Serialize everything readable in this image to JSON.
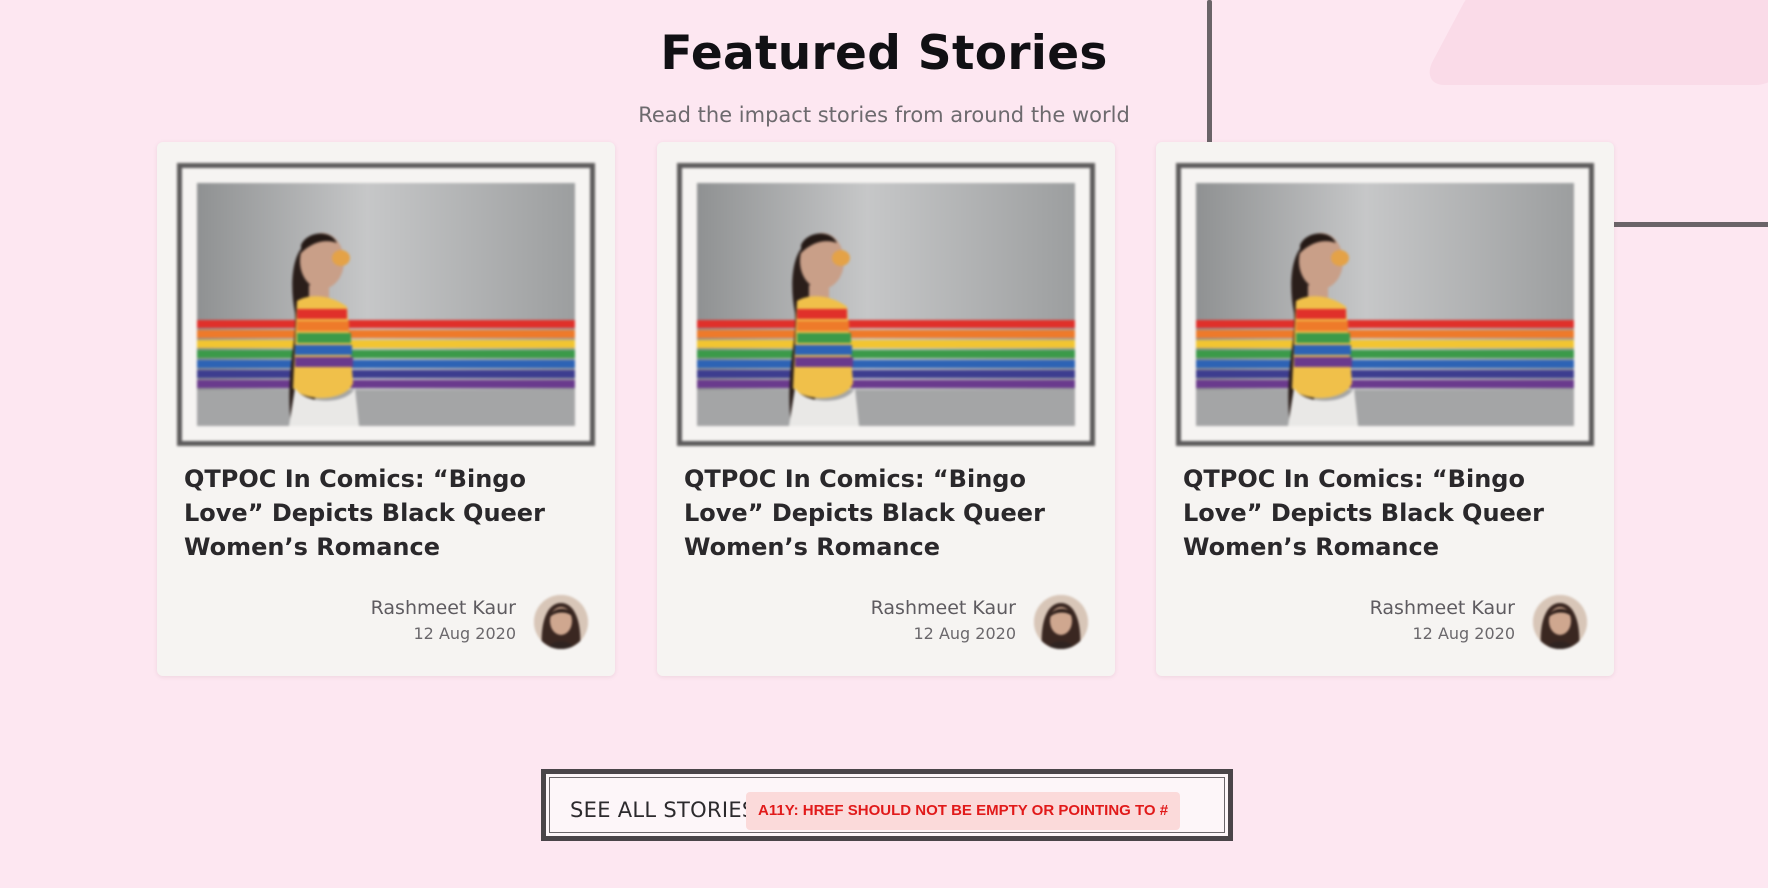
{
  "section": {
    "title": "Featured Stories",
    "subtitle": "Read the impact stories from around the world"
  },
  "cards": [
    {
      "title": "QTPOC In Comics: “Bingo Love” Depicts Black Queer Women’s Romance",
      "author": "Rashmeet Kaur",
      "date": "12 Aug 2020",
      "image": "woman-rainbow-stripes-photo",
      "avatar": "author-avatar"
    },
    {
      "title": "QTPOC In Comics: “Bingo Love” Depicts Black Queer Women’s Romance",
      "author": "Rashmeet Kaur",
      "date": "12 Aug 2020",
      "image": "woman-rainbow-stripes-photo",
      "avatar": "author-avatar"
    },
    {
      "title": "QTPOC In Comics: “Bingo Love” Depicts Black Queer Women’s Romance",
      "author": "Rashmeet Kaur",
      "date": "12 Aug 2020",
      "image": "woman-rainbow-stripes-photo",
      "avatar": "author-avatar"
    }
  ],
  "cta": {
    "label": "SEE ALL STORIES",
    "a11y_warning": "A11Y: HREF SHOULD NOT BE EMPTY OR POINTING TO #"
  },
  "colors": {
    "page_background": "#fde7f1",
    "card_background": "#f6f4f2",
    "warning_text": "#e11a1a",
    "warning_background": "#fbdada"
  }
}
